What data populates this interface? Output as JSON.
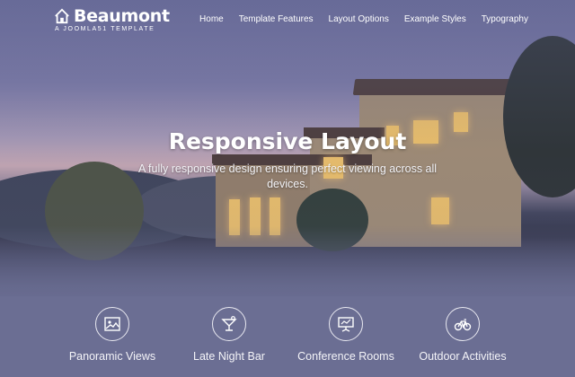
{
  "brand": {
    "title": "Beaumont",
    "subtitle": "A JOOMLA51 TEMPLATE"
  },
  "nav": {
    "items": [
      {
        "label": "Home"
      },
      {
        "label": "Template Features"
      },
      {
        "label": "Layout Options"
      },
      {
        "label": "Example Styles"
      },
      {
        "label": "Typography"
      }
    ]
  },
  "hero": {
    "title": "Responsive Layout",
    "subtitle": "A fully responsive design ensuring perfect viewing across all devices."
  },
  "features": [
    {
      "icon": "picture-icon",
      "label": "Panoramic Views"
    },
    {
      "icon": "cocktail-icon",
      "label": "Late Night Bar"
    },
    {
      "icon": "presentation-icon",
      "label": "Conference Rooms"
    },
    {
      "icon": "bicycle-icon",
      "label": "Outdoor Activities"
    }
  ],
  "colors": {
    "background": "#6b6e93",
    "text": "#ffffff"
  }
}
